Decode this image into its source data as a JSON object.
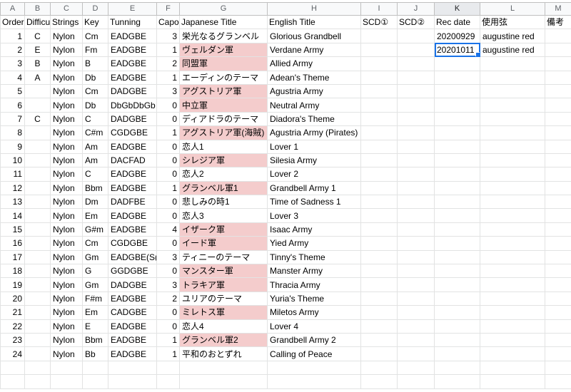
{
  "columns": [
    "A",
    "B",
    "C",
    "D",
    "E",
    "F",
    "G",
    "H",
    "I",
    "J",
    "K",
    "L",
    "M"
  ],
  "selected_column": "K",
  "header_row": [
    "Order",
    "Difficult",
    "Strings",
    "Key",
    "Tunning",
    "Capo",
    "Japanese Title",
    "English Title",
    "SCD①",
    "SCD②",
    "Rec date",
    "使用弦",
    "備考"
  ],
  "rows": [
    [
      "1",
      "C",
      "Nylon",
      "Cm",
      "EADGBE",
      "3",
      "栄光なるグランベル",
      "Glorious Grandbell",
      "",
      "",
      "20200929",
      "augustine red",
      ""
    ],
    [
      "2",
      "E",
      "Nylon",
      "Fm",
      "EADGBE",
      "1",
      "ヴェルダン軍",
      "Verdane Army",
      "",
      "",
      "20201011",
      "augustine red",
      ""
    ],
    [
      "3",
      "B",
      "Nylon",
      "B",
      "EADGBE",
      "2",
      "同盟軍",
      "Allied Army",
      "",
      "",
      "",
      "",
      ""
    ],
    [
      "4",
      "A",
      "Nylon",
      "Db",
      "EADGBE",
      "1",
      "エーディンのテーマ",
      "Adean's Theme",
      "",
      "",
      "",
      "",
      ""
    ],
    [
      "5",
      "",
      "Nylon",
      "Cm",
      "DADGBE",
      "3",
      "アグストリア軍",
      "Agustria Army",
      "",
      "",
      "",
      "",
      ""
    ],
    [
      "6",
      "",
      "Nylon",
      "Db",
      "DbGbDbGb",
      "0",
      "中立軍",
      "Neutral Army",
      "",
      "",
      "",
      "",
      ""
    ],
    [
      "7",
      "C",
      "Nylon",
      "C",
      "DADGBE",
      "0",
      "ディアドラのテーマ",
      "Diadora's Theme",
      "",
      "",
      "",
      "",
      ""
    ],
    [
      "8",
      "",
      "Nylon",
      "C#m",
      "CGDGBE",
      "1",
      "アグストリア軍(海賊)",
      "Agustria Army (Pirates)",
      "",
      "",
      "",
      "",
      ""
    ],
    [
      "9",
      "",
      "Nylon",
      "Am",
      "EADGBE",
      "0",
      "恋人1",
      "Lover 1",
      "",
      "",
      "",
      "",
      ""
    ],
    [
      "10",
      "",
      "Nylon",
      "Am",
      "DACFAD",
      "0",
      "シレジア軍",
      "Silesia Army",
      "",
      "",
      "",
      "",
      ""
    ],
    [
      "11",
      "",
      "Nylon",
      "C",
      "EADGBE",
      "0",
      "恋人2",
      "Lover 2",
      "",
      "",
      "",
      "",
      ""
    ],
    [
      "12",
      "",
      "Nylon",
      "Bbm",
      "EADGBE",
      "1",
      "グランベル軍1",
      "Grandbell Army 1",
      "",
      "",
      "",
      "",
      ""
    ],
    [
      "13",
      "",
      "Nylon",
      "Dm",
      "DADFBE",
      "0",
      "悲しみの時1",
      "Time of Sadness 1",
      "",
      "",
      "",
      "",
      ""
    ],
    [
      "14",
      "",
      "Nylon",
      "Em",
      "EADGBE",
      "0",
      "恋人3",
      "Lover 3",
      "",
      "",
      "",
      "",
      ""
    ],
    [
      "15",
      "",
      "Nylon",
      "G#m",
      "EADGBE",
      "4",
      "イザーク軍",
      "Isaac Army",
      "",
      "",
      "",
      "",
      ""
    ],
    [
      "16",
      "",
      "Nylon",
      "Cm",
      "CGDGBE",
      "0",
      "イード軍",
      "Yied Army",
      "",
      "",
      "",
      "",
      ""
    ],
    [
      "17",
      "",
      "Nylon",
      "Gm",
      "EADGBE(S(",
      "3",
      "ティニーのテーマ",
      "Tinny's Theme",
      "",
      "",
      "",
      "",
      ""
    ],
    [
      "18",
      "",
      "Nylon",
      "G",
      "GGDGBE",
      "0",
      "マンスター軍",
      "Manster Army",
      "",
      "",
      "",
      "",
      ""
    ],
    [
      "19",
      "",
      "Nylon",
      "Gm",
      "DADGBE",
      "3",
      "トラキア軍",
      "Thracia Army",
      "",
      "",
      "",
      "",
      ""
    ],
    [
      "20",
      "",
      "Nylon",
      "F#m",
      "EADGBE",
      "2",
      "ユリアのテーマ",
      "Yuria's Theme",
      "",
      "",
      "",
      "",
      ""
    ],
    [
      "21",
      "",
      "Nylon",
      "Em",
      "CADGBE",
      "0",
      "ミレトス軍",
      "Miletos Army",
      "",
      "",
      "",
      "",
      ""
    ],
    [
      "22",
      "",
      "Nylon",
      "E",
      "EADGBE",
      "0",
      "恋人4",
      "Lover 4",
      "",
      "",
      "",
      "",
      ""
    ],
    [
      "23",
      "",
      "Nylon",
      "Bbm",
      "EADGBE",
      "1",
      "グランベル軍2",
      "Grandbell Army 2",
      "",
      "",
      "",
      "",
      ""
    ],
    [
      "24",
      "",
      "Nylon",
      "Bb",
      "EADGBE",
      "1",
      "平和のおとずれ",
      "Calling of Peace",
      "",
      "",
      "",
      "",
      ""
    ]
  ],
  "pink_rows": [
    2,
    3,
    5,
    6,
    8,
    10,
    12,
    15,
    16,
    18,
    19,
    21,
    23
  ],
  "pink_color": "#f4cccc",
  "selection_color": "#1a73e8",
  "selected_cell": {
    "row": 2,
    "col": "K"
  },
  "empty_rows_after": 2
}
